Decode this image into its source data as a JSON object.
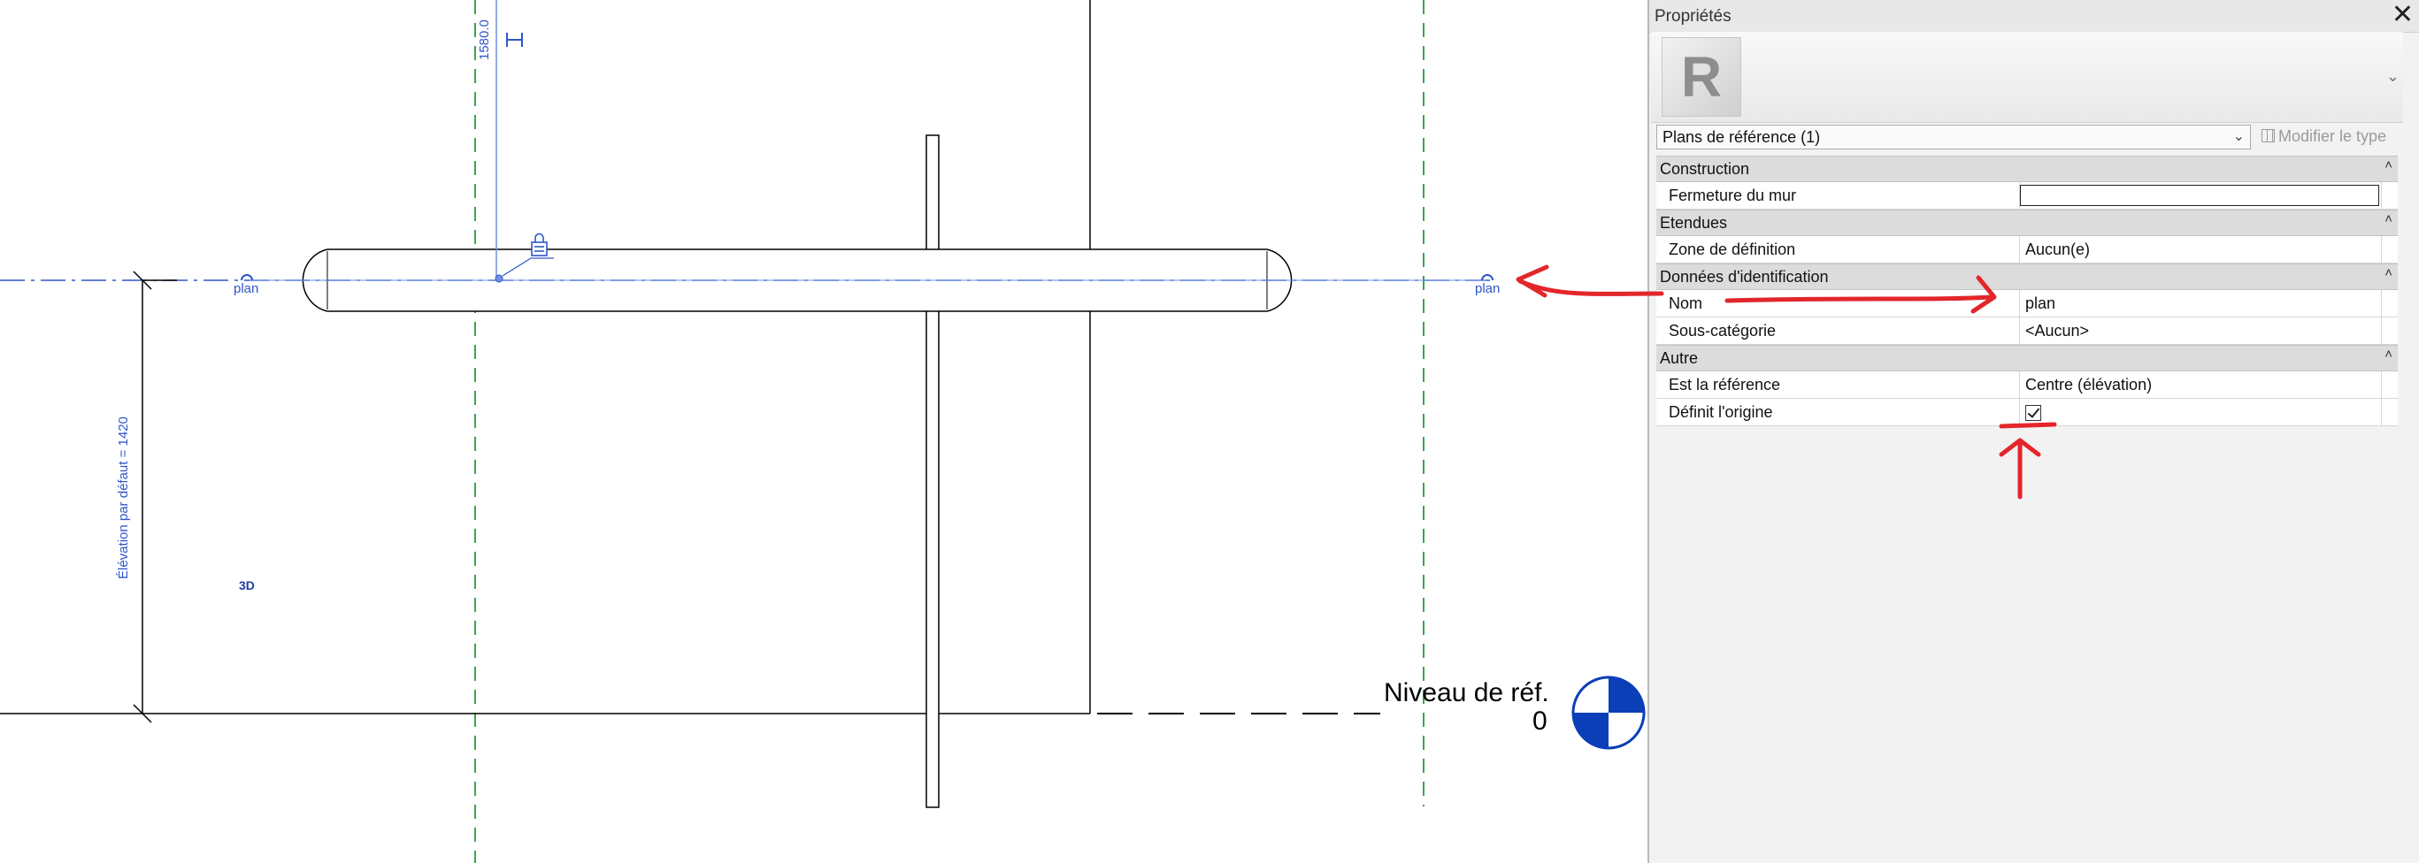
{
  "viewport": {
    "dimension_label": "1580.0",
    "elevation_label": "Élévation par défaut = 1420",
    "plan_label_left": "plan",
    "plan_label_right": "plan",
    "view_3d_label": "3D",
    "level_name": "Niveau de réf.",
    "level_value": "0"
  },
  "properties": {
    "title": "Propriétés",
    "selector_label": "Plans de référence (1)",
    "edit_type_label": "Modifier le type",
    "groups": [
      {
        "name": "Construction",
        "rows": [
          {
            "name": "Fermeture du mur",
            "value": "",
            "kind": "checkbox",
            "checked": false
          }
        ]
      },
      {
        "name": "Etendues",
        "rows": [
          {
            "name": "Zone de définition",
            "value": "Aucun(e)",
            "kind": "text"
          }
        ]
      },
      {
        "name": "Données d'identification",
        "rows": [
          {
            "name": "Nom",
            "value": "plan",
            "kind": "text"
          },
          {
            "name": "Sous-catégorie",
            "value": "<Aucun>",
            "kind": "text"
          }
        ]
      },
      {
        "name": "Autre",
        "rows": [
          {
            "name": "Est la référence",
            "value": "Centre (élévation)",
            "kind": "text"
          },
          {
            "name": "Définit l'origine",
            "value": "",
            "kind": "checkbox",
            "checked": true
          }
        ]
      }
    ]
  },
  "colors": {
    "annotation_red": "#e3262b",
    "ref_plane_blue": "#2f56c9",
    "level_target_blue": "#0a3fb8",
    "green_dashed": "#3aa64a"
  }
}
